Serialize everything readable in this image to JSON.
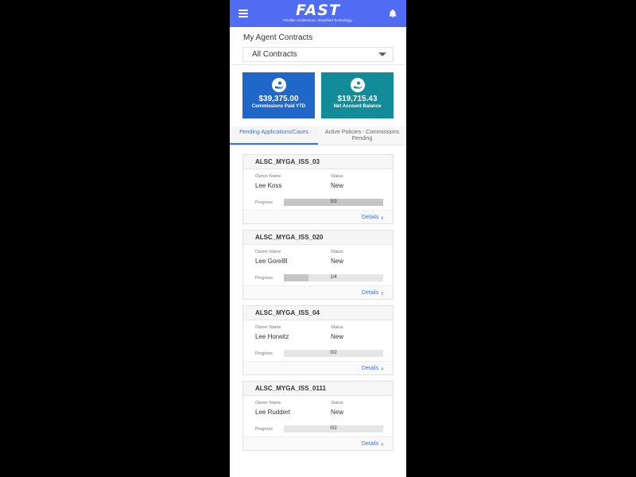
{
  "header": {
    "logo_text": "FAST",
    "tagline": "Flexible Architecture. Simplified Technology."
  },
  "contracts": {
    "title": "My Agent Contracts",
    "selected": "All Contracts"
  },
  "summary": {
    "commissions": {
      "amount": "$39,375.00",
      "label": "Commissions Paid YTD",
      "color": "#1f67c8"
    },
    "balance": {
      "amount": "$19,715.43",
      "label": "Net Account Balance",
      "color": "#128c99"
    }
  },
  "tabs": [
    {
      "label": "Pending Applications/Cases",
      "active": true
    },
    {
      "label": "Active Policies - Commissions Pending",
      "active": false
    }
  ],
  "case_labels": {
    "owner": "Owner Name",
    "status": "Status",
    "progress": "Progress",
    "details": "Details"
  },
  "cases": [
    {
      "id": "ALSC_MYGA_ISS_03",
      "owner": "Lee Koss",
      "status": "New",
      "progress_text": "3/3",
      "progress": 1.0
    },
    {
      "id": "ALSC_MYGA_ISS_020",
      "owner": "Lee Gorellll",
      "status": "New",
      "progress_text": "1/4",
      "progress": 0.25
    },
    {
      "id": "ALSC_MYGA_ISS_04",
      "owner": "Lee Horwitz",
      "status": "New",
      "progress_text": "0/2",
      "progress": 0.0
    },
    {
      "id": "ALSC_MYGA_ISS_0111",
      "owner": "Lee Ruddert",
      "status": "New",
      "progress_text": "0/2",
      "progress": 0.0
    }
  ],
  "icons": {
    "menu": "hamburger-menu-icon",
    "notifications": "bell-icon",
    "commissions": "hand-coin-icon",
    "balance": "hand-coin-icon",
    "details": "chevron-right-icon",
    "select": "caret-down-icon"
  }
}
